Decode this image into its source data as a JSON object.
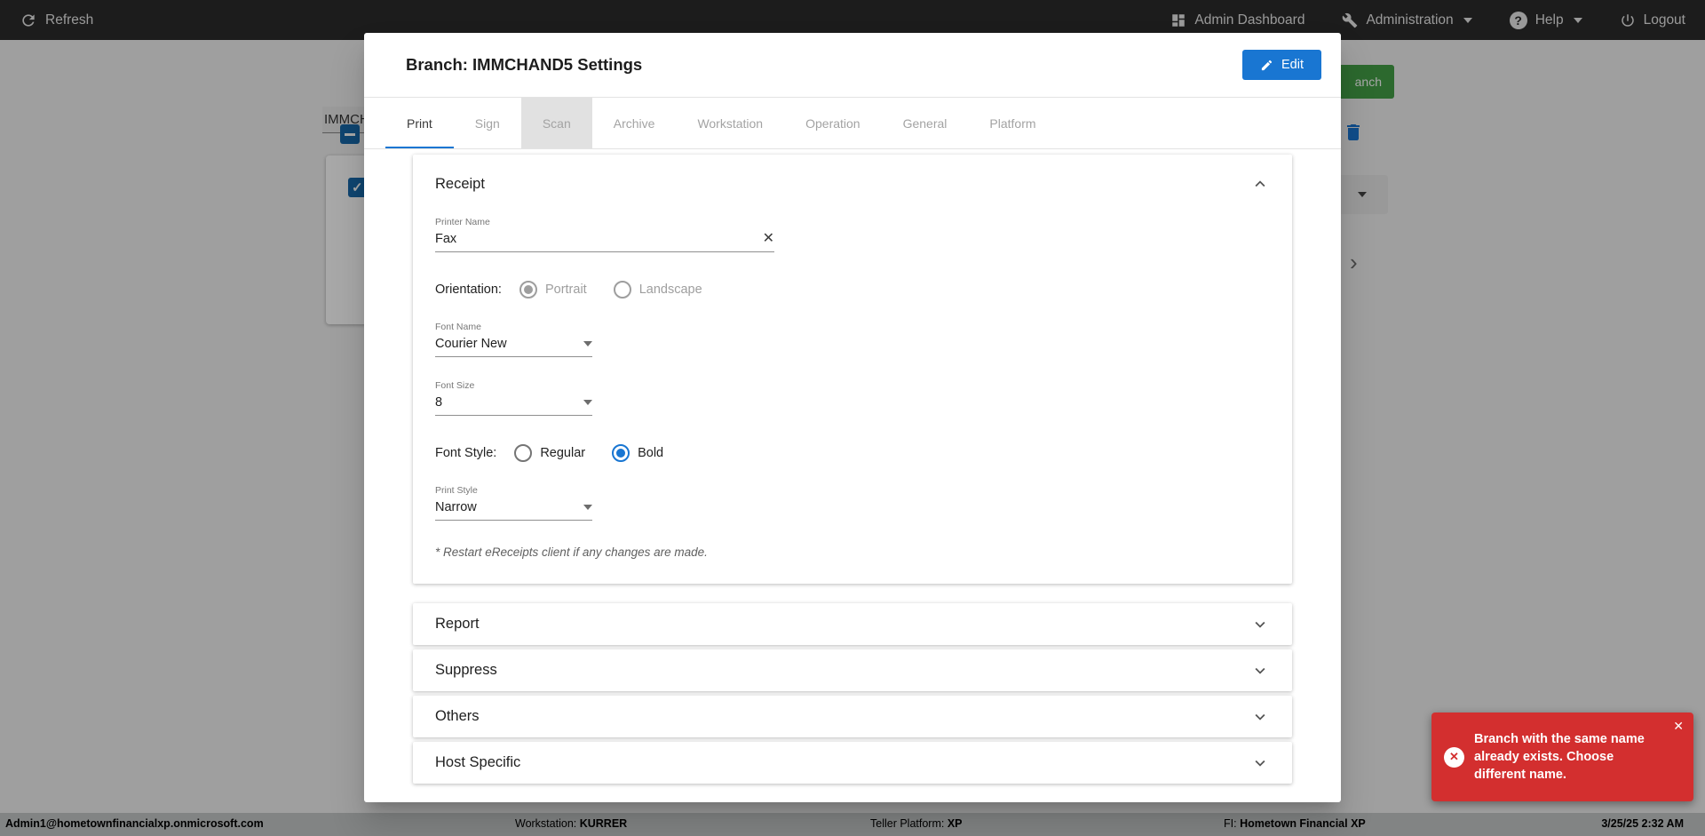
{
  "topbar": {
    "refresh": "Refresh",
    "admin_dashboard": "Admin Dashboard",
    "administration": "Administration",
    "help": "Help",
    "logout": "Logout"
  },
  "modal": {
    "title": "Branch: IMMCHAND5 Settings",
    "edit_label": "Edit",
    "tabs": [
      {
        "label": "Print",
        "active": true
      },
      {
        "label": "Sign"
      },
      {
        "label": "Scan",
        "highlighted": true
      },
      {
        "label": "Archive"
      },
      {
        "label": "Workstation"
      },
      {
        "label": "Operation"
      },
      {
        "label": "General"
      },
      {
        "label": "Platform"
      }
    ],
    "receipt": {
      "title": "Receipt",
      "printer_name_label": "Printer Name",
      "printer_name_value": "Fax",
      "orientation_label": "Orientation:",
      "orientation_options": [
        "Portrait",
        "Landscape"
      ],
      "orientation_selected": "Portrait",
      "font_name_label": "Font Name",
      "font_name_value": "Courier New",
      "font_size_label": "Font Size",
      "font_size_value": "8",
      "font_style_label": "Font Style:",
      "font_style_options": [
        "Regular",
        "Bold"
      ],
      "font_style_selected": "Bold",
      "print_style_label": "Print Style",
      "print_style_value": "Narrow",
      "note": "* Restart eReceipts client if any changes are made."
    },
    "sections": [
      "Report",
      "Suppress",
      "Others",
      "Host Specific"
    ]
  },
  "toast": {
    "message": "Branch with the same name already exists. Choose different name."
  },
  "statusbar": {
    "user": "Admin1@hometownfinancialxp.onmicrosoft.com",
    "workstation_label": "Workstation: ",
    "workstation_value": "KURRER",
    "platform_label": "Teller Platform: ",
    "platform_value": "XP",
    "fi_label": "FI: ",
    "fi_value": "Hometown Financial XP",
    "timestamp": "3/25/25 2:32 AM"
  },
  "background": {
    "branch_field_value": "IMMCH",
    "add_branch_fragment": "anch"
  },
  "icons": {
    "close": "✕",
    "error": "✕",
    "help": "?",
    "chevron_right": "›"
  },
  "colors": {
    "accent_blue": "#1976d2",
    "error_red": "#d32f2f",
    "success_green": "#43a047",
    "topbar_dark": "#2b2b2b"
  }
}
